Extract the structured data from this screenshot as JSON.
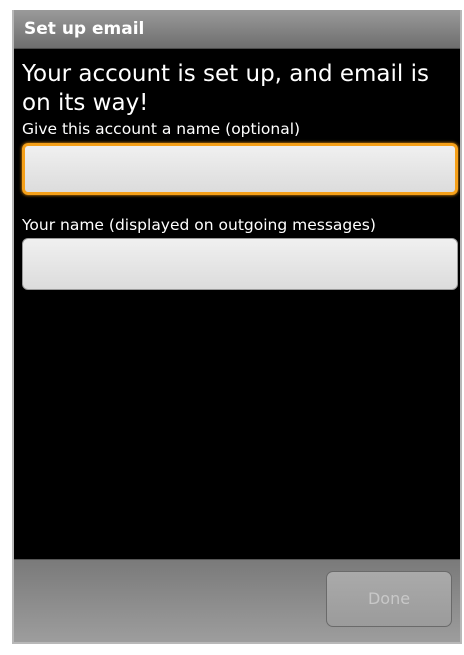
{
  "titlebar": {
    "title": "Set up email"
  },
  "main": {
    "headline": "Your account is set up, and email is on its way!",
    "account_name": {
      "label": "Give this account a name (optional)",
      "value": "",
      "placeholder": ""
    },
    "your_name": {
      "label": "Your name (displayed on outgoing messages)",
      "value": "",
      "placeholder": ""
    }
  },
  "footer": {
    "done_label": "Done",
    "done_enabled": false
  },
  "colors": {
    "focus_accent": "#f5a019",
    "background": "#000000",
    "titlebar": "#8a8a8a"
  }
}
